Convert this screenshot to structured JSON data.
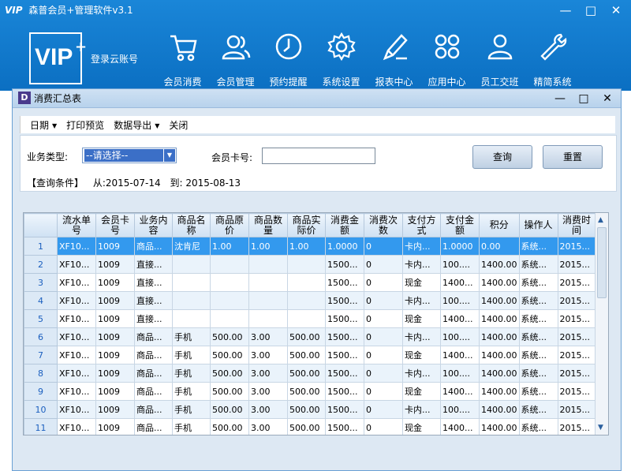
{
  "app": {
    "logo_text": "VIP",
    "title": "森普会员+管理软件v3.1",
    "minimize": "—",
    "maximize": "□",
    "close": "✕",
    "logo_big": "VIP",
    "logo_plus": "+",
    "cloud_login": "登录云账号"
  },
  "nav": [
    {
      "label": "会员消费",
      "icon": "shopping-cart-icon"
    },
    {
      "label": "会员管理",
      "icon": "users-icon"
    },
    {
      "label": "预约提醒",
      "icon": "clock-icon"
    },
    {
      "label": "系统设置",
      "icon": "gear-icon"
    },
    {
      "label": "报表中心",
      "icon": "pencil-icon"
    },
    {
      "label": "应用中心",
      "icon": "apps-grid-icon"
    },
    {
      "label": "员工交班",
      "icon": "person-icon"
    },
    {
      "label": "精简系统",
      "icon": "wrench-icon"
    }
  ],
  "dialog": {
    "icon_letter": "D",
    "title": "消费汇总表",
    "minimize": "—",
    "maximize": "□",
    "close": "✕"
  },
  "menu": {
    "date": "日期",
    "print_preview": "打印预览",
    "export": "数据导出",
    "close": "关闭"
  },
  "query": {
    "type_label": "业务类型:",
    "type_selected": "--请选择--",
    "card_label": "会员卡号:",
    "card_value": "",
    "search_btn": "查询",
    "reset_btn": "重置",
    "cond_label": "【查询条件】",
    "from_label": "从:2015-07-14",
    "to_label": "到: 2015-08-13"
  },
  "colors": {
    "header_blue": "#0b6fc2",
    "selected_row": "#3399ee"
  },
  "grid": {
    "columns": [
      "流水单号",
      "会员卡号",
      "业务内容",
      "商品名称",
      "商品原价",
      "商品数量",
      "商品实际价",
      "消费金额",
      "消费次数",
      "支付方式",
      "支付金额",
      "积分",
      "操作人",
      "消费时间"
    ],
    "rows": [
      {
        "n": "1",
        "cells": [
          "XF10...",
          "1009",
          "商品...",
          "沈肯尼",
          "1.00",
          "1.00",
          "1.00",
          "1.0000",
          "0",
          "卡内...",
          "1.0000",
          "0.00",
          "系统...",
          "2015..."
        ]
      },
      {
        "n": "2",
        "cells": [
          "XF10...",
          "1009",
          "直接...",
          "",
          "",
          "",
          "",
          "1500...",
          "0",
          "卡内...",
          "100....",
          "1400.00",
          "系统...",
          "2015..."
        ]
      },
      {
        "n": "3",
        "cells": [
          "XF10...",
          "1009",
          "直接...",
          "",
          "",
          "",
          "",
          "1500...",
          "0",
          "现金",
          "1400...",
          "1400.00",
          "系统...",
          "2015..."
        ]
      },
      {
        "n": "4",
        "cells": [
          "XF10...",
          "1009",
          "直接...",
          "",
          "",
          "",
          "",
          "1500...",
          "0",
          "卡内...",
          "100....",
          "1400.00",
          "系统...",
          "2015..."
        ]
      },
      {
        "n": "5",
        "cells": [
          "XF10...",
          "1009",
          "直接...",
          "",
          "",
          "",
          "",
          "1500...",
          "0",
          "现金",
          "1400...",
          "1400.00",
          "系统...",
          "2015..."
        ]
      },
      {
        "n": "6",
        "cells": [
          "XF10...",
          "1009",
          "商品...",
          "手机",
          "500.00",
          "3.00",
          "500.00",
          "1500...",
          "0",
          "卡内...",
          "100....",
          "1400.00",
          "系统...",
          "2015..."
        ]
      },
      {
        "n": "7",
        "cells": [
          "XF10...",
          "1009",
          "商品...",
          "手机",
          "500.00",
          "3.00",
          "500.00",
          "1500...",
          "0",
          "现金",
          "1400...",
          "1400.00",
          "系统...",
          "2015..."
        ]
      },
      {
        "n": "8",
        "cells": [
          "XF10...",
          "1009",
          "商品...",
          "手机",
          "500.00",
          "3.00",
          "500.00",
          "1500...",
          "0",
          "卡内...",
          "100....",
          "1400.00",
          "系统...",
          "2015..."
        ]
      },
      {
        "n": "9",
        "cells": [
          "XF10...",
          "1009",
          "商品...",
          "手机",
          "500.00",
          "3.00",
          "500.00",
          "1500...",
          "0",
          "现金",
          "1400...",
          "1400.00",
          "系统...",
          "2015..."
        ]
      },
      {
        "n": "10",
        "cells": [
          "XF10...",
          "1009",
          "商品...",
          "手机",
          "500.00",
          "3.00",
          "500.00",
          "1500...",
          "0",
          "卡内...",
          "100....",
          "1400.00",
          "系统...",
          "2015..."
        ]
      },
      {
        "n": "11",
        "cells": [
          "XF10...",
          "1009",
          "商品...",
          "手机",
          "500.00",
          "3.00",
          "500.00",
          "1500...",
          "0",
          "现金",
          "1400...",
          "1400.00",
          "系统...",
          "2015..."
        ]
      }
    ],
    "selected_row": 0
  }
}
